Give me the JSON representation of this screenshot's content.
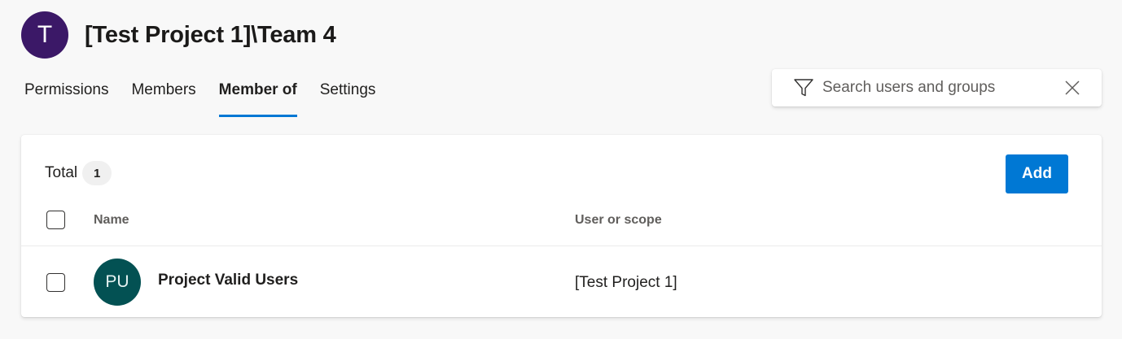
{
  "header": {
    "avatar_initial": "T",
    "title": "[Test Project 1]\\Team 4",
    "avatar_color": "#3b1867"
  },
  "tabs": [
    {
      "label": "Permissions",
      "active": false
    },
    {
      "label": "Members",
      "active": false
    },
    {
      "label": "Member of",
      "active": true
    },
    {
      "label": "Settings",
      "active": false
    }
  ],
  "search": {
    "placeholder": "Search users and groups",
    "value": "",
    "filter_icon": "filter-icon",
    "clear_icon": "close-icon"
  },
  "card": {
    "total_label": "Total",
    "total_count": "1",
    "add_label": "Add",
    "columns": {
      "name": "Name",
      "scope": "User or scope"
    },
    "rows": [
      {
        "initials": "PU",
        "name": "Project Valid Users",
        "scope": "[Test Project 1]",
        "avatar_color": "#035153",
        "checked": false
      }
    ]
  },
  "colors": {
    "accent": "#0078d4",
    "background": "#f8f8f8"
  }
}
